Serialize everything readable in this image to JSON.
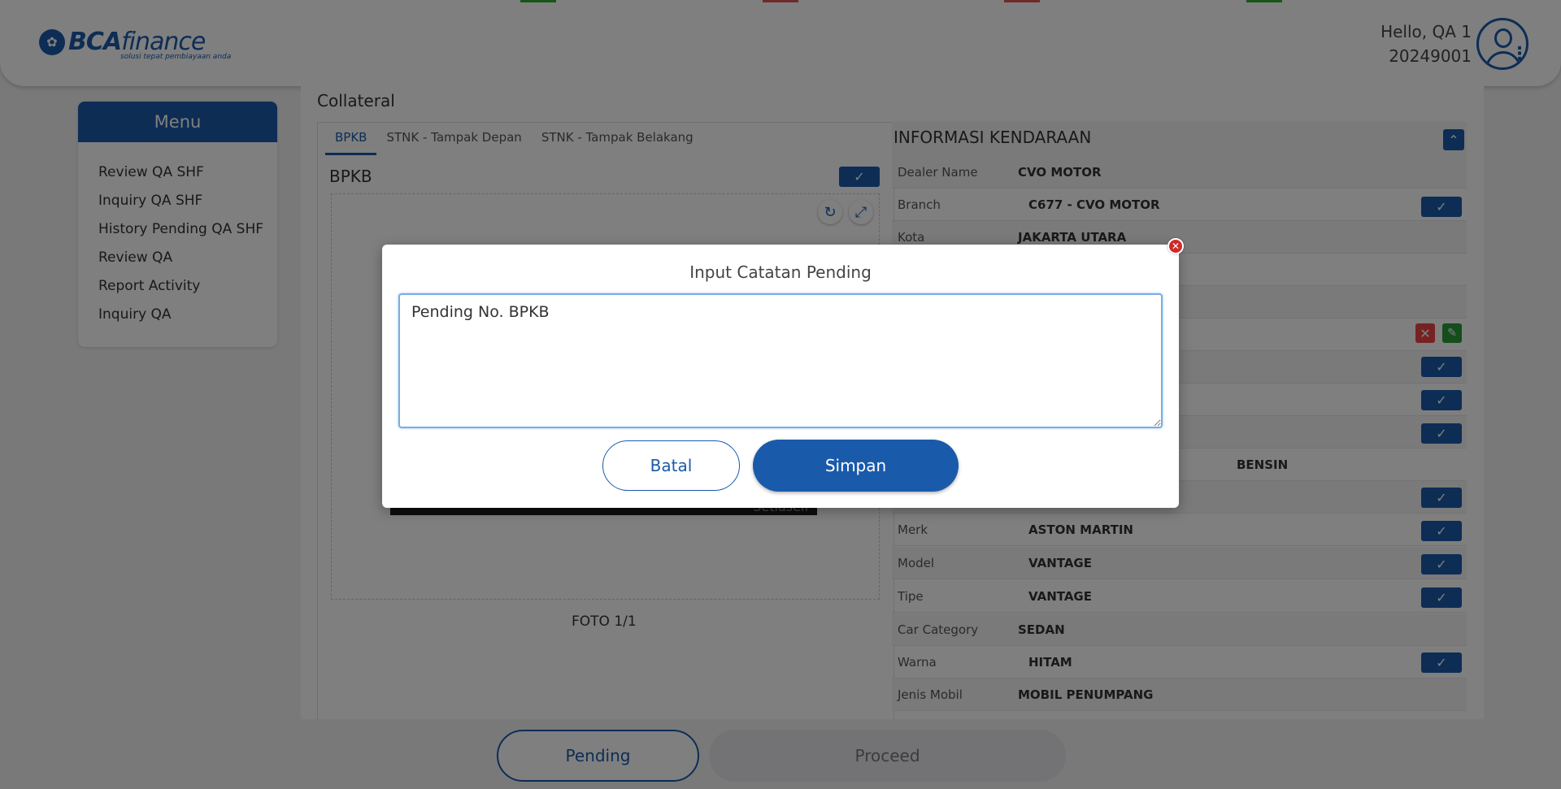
{
  "brand": {
    "name_bold": "BCA",
    "name_light": "finance",
    "tagline": "solusi tepat pembiayaan anda"
  },
  "user": {
    "greeting": "Hello, QA 1",
    "id": "20249001"
  },
  "menu": {
    "title": "Menu",
    "items": [
      "Review QA SHF",
      "Inquiry QA SHF",
      "History Pending QA SHF",
      "Review QA",
      "Report Activity",
      "Inquiry QA"
    ]
  },
  "collateral": {
    "title": "Collateral",
    "tabs": [
      "BPKB",
      "STNK - Tampak Depan",
      "STNK - Tampak Belakang"
    ],
    "doc_title": "BPKB",
    "foto_label": "FOTO 1/1",
    "watermark": "Setiaself"
  },
  "info": {
    "title": "INFORMASI KENDARAAN",
    "rows": [
      {
        "label": "Dealer Name",
        "value": "CVO MOTOR"
      },
      {
        "label": "Branch",
        "value": "C677 - CVO MOTOR"
      },
      {
        "label": "Kota",
        "value": "JAKARTA UTARA"
      },
      {
        "label": "",
        "value": "BENSIN"
      },
      {
        "label": "Merk",
        "value": "ASTON MARTIN"
      },
      {
        "label": "Model",
        "value": "VANTAGE"
      },
      {
        "label": "Tipe",
        "value": "VANTAGE"
      },
      {
        "label": "Car Category",
        "value": "SEDAN"
      },
      {
        "label": "Warna",
        "value": "HITAM"
      },
      {
        "label": "Jenis Mobil",
        "value": "MOBIL PENUMPANG"
      }
    ]
  },
  "footer": {
    "pending": "Pending",
    "proceed": "Proceed"
  },
  "modal": {
    "title": "Input Catatan Pending",
    "note_value": "Pending No. BPKB",
    "cancel": "Batal",
    "save": "Simpan"
  },
  "colors": {
    "primary": "#1a5aab",
    "danger": "#d02a2a",
    "success": "#2a9b3a"
  },
  "icons": {
    "check": "check-icon",
    "close": "close-icon",
    "refresh": "refresh-icon",
    "expand": "expand-icon",
    "edit": "pencil-icon",
    "collapse": "chevron-up-icon"
  }
}
